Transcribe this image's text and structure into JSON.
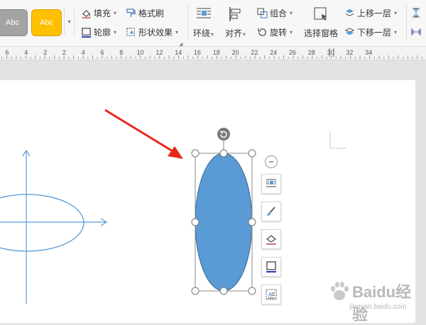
{
  "ribbon": {
    "style_gallery": [
      "Abc",
      "Abc"
    ],
    "fill_label": "填充",
    "format_painter_label": "格式刷",
    "outline_label": "轮廓",
    "shape_effect_label": "形状效果",
    "wrap_label": "环绕",
    "align_label": "对齐",
    "group_label": "组合",
    "rotate_label": "旋转",
    "selection_pane_label": "选择窗格",
    "bring_forward_label": "上移一层",
    "send_backward_label": "下移一层"
  },
  "ruler": {
    "labels": [
      "6",
      "4",
      "2",
      "2",
      "4",
      "6",
      "8",
      "10",
      "12",
      "14",
      "16",
      "18",
      "20",
      "22",
      "24",
      "26",
      "28",
      "30",
      "32",
      "34"
    ]
  },
  "watermark": {
    "text": "Baidu经验",
    "sub": "jingyan.baidu.com"
  },
  "colors": {
    "ellipse_fill": "#5b9bd5",
    "arrow_red": "#e8271b",
    "axis_blue": "#5b9bd5",
    "style_orange": "#ffc000"
  }
}
